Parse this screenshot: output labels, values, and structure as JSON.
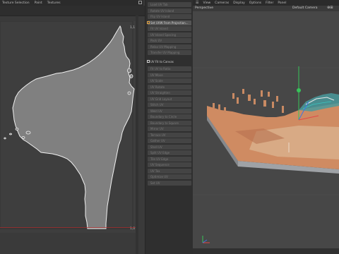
{
  "left_menu": {
    "items": [
      "Texture Selection",
      "Paint",
      "Textures"
    ]
  },
  "uv_editor": {
    "tile_label_top": "1,1",
    "tile_label_bottom": "1,0"
  },
  "tools_panel": {
    "items": [
      {
        "label": "Load UV Tab",
        "state": "dim"
      },
      {
        "label": "Rotate UV Island",
        "state": "dim"
      },
      {
        "label": "Flip UV Island",
        "state": "dim"
      },
      {
        "label": "Set UVW From Projection...",
        "state": "active"
      },
      {
        "label": "Fit UV Island",
        "state": "dim"
      },
      {
        "label": "UV Island Spacing",
        "state": "dim"
      },
      {
        "label": "Pack UV",
        "state": "dim"
      },
      {
        "label": "Relax UV Mapping",
        "state": "dim"
      },
      {
        "label": "Transfer UV Mapping",
        "state": "dim"
      },
      {
        "label": "UV Fit to Canvas",
        "state": "header"
      },
      {
        "label": "Fit UV to Ratio",
        "state": "dim"
      },
      {
        "label": "UV Move",
        "state": "dim"
      },
      {
        "label": "UV Scale",
        "state": "dim"
      },
      {
        "label": "UV Rotate",
        "state": "dim"
      },
      {
        "label": "UV Straighten",
        "state": "dim"
      },
      {
        "label": "UV Grid Layout",
        "state": "dim"
      },
      {
        "label": "Stitch UV",
        "state": "dim"
      },
      {
        "label": "Weld UV",
        "state": "dim"
      },
      {
        "label": "Boundary to Circle",
        "state": "dim"
      },
      {
        "label": "Boundary to Square",
        "state": "dim"
      },
      {
        "label": "Mirror UV",
        "state": "dim"
      },
      {
        "label": "Terrace UV",
        "state": "dim"
      },
      {
        "label": "Gather UV",
        "state": "dim"
      },
      {
        "label": "Shell UV",
        "state": "dim"
      },
      {
        "label": "Split UV Edge",
        "state": "dim"
      },
      {
        "label": "Tile UV Edge",
        "state": "dim"
      },
      {
        "label": "UV Sequence",
        "state": "dim"
      },
      {
        "label": "UV Tex",
        "state": "dim"
      },
      {
        "label": "Optimize UV",
        "state": "dim"
      },
      {
        "label": "Set UV",
        "state": "dim"
      }
    ]
  },
  "viewport": {
    "menu": [
      "View",
      "Cameras",
      "Display",
      "Options",
      "Filter",
      "Panel"
    ],
    "projection_label": "Perspective",
    "camera_label": "Default Camera"
  },
  "colors": {
    "uv_fill": "#808080",
    "uv_outline": "#f0f0f0",
    "axis_red": "#e24848",
    "axis_green": "#37c45a",
    "axis_blue": "#3d76e3",
    "terrain_orange": "#cf8b62",
    "terrain_tan": "#d9b18e",
    "terrain_base": "#9fa2a6"
  }
}
